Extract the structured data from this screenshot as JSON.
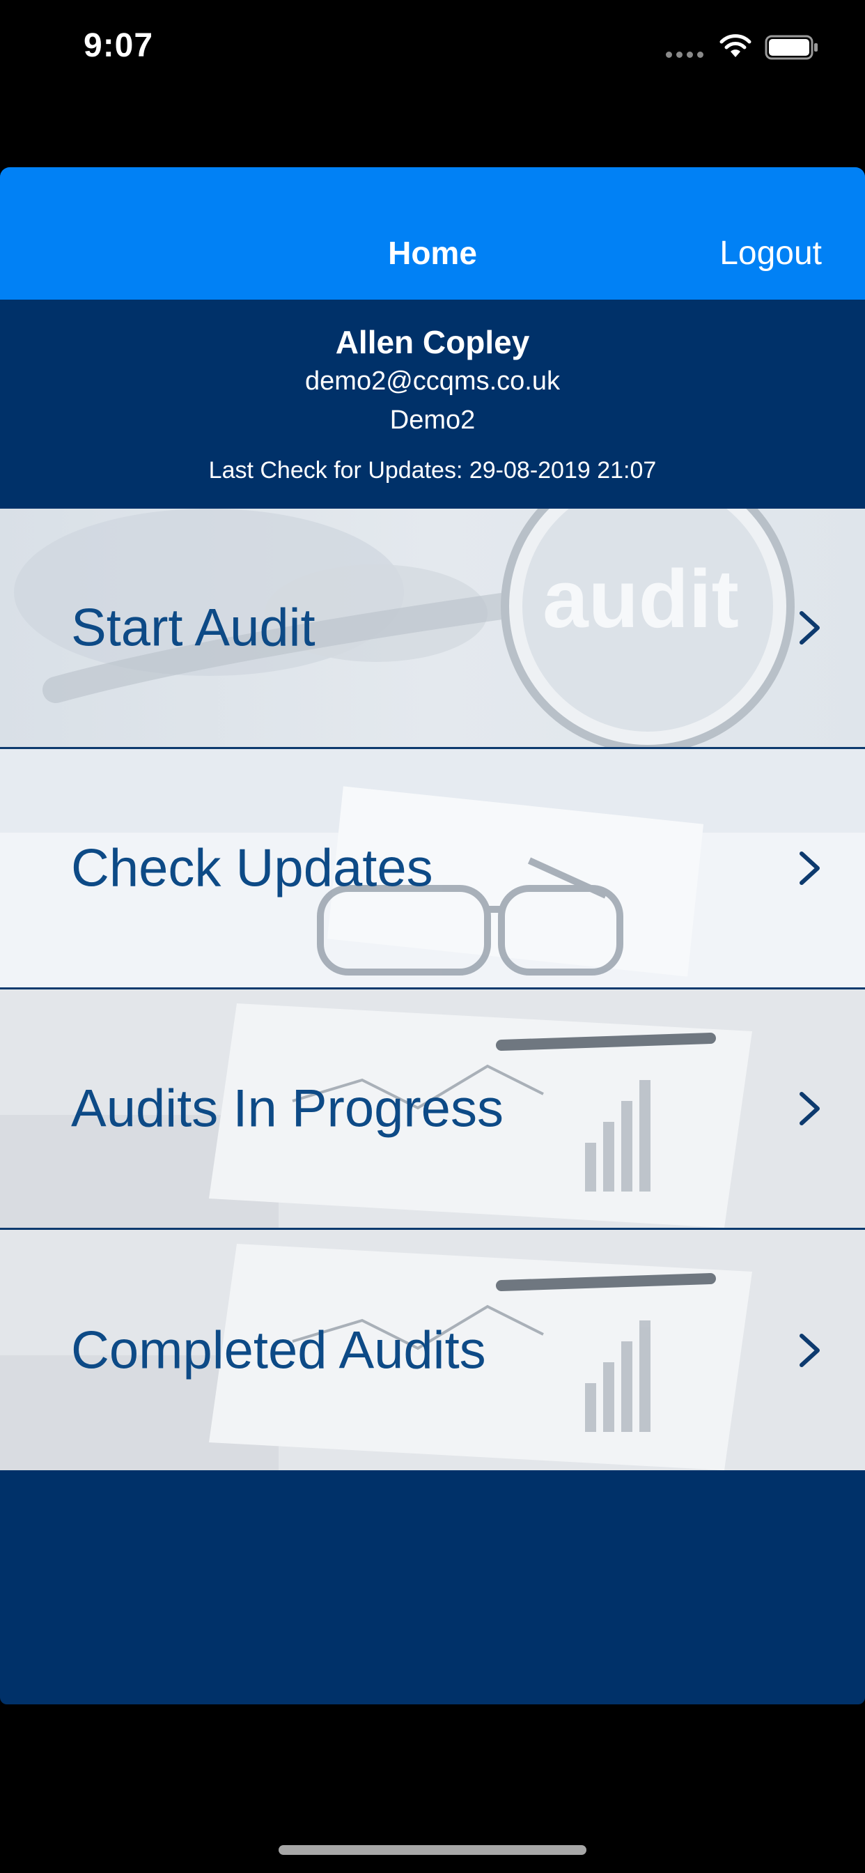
{
  "status_bar": {
    "time": "9:07"
  },
  "navbar": {
    "title": "Home",
    "logout_label": "Logout",
    "background": "#0181f5"
  },
  "profile": {
    "name": "Allen Copley",
    "email": "demo2@ccqms.co.uk",
    "company": "Demo2",
    "last_check": "Last Check for Updates: 29-08-2019 21:07",
    "background": "#003169"
  },
  "menu": {
    "items": [
      {
        "label": "Start Audit",
        "icon": "chevron-right-icon",
        "image_caption": "audit"
      },
      {
        "label": "Check Updates",
        "icon": "chevron-right-icon"
      },
      {
        "label": "Audits In Progress",
        "icon": "chevron-right-icon"
      },
      {
        "label": "Completed Audits",
        "icon": "chevron-right-icon"
      }
    ],
    "label_color": "#0d4a86"
  }
}
